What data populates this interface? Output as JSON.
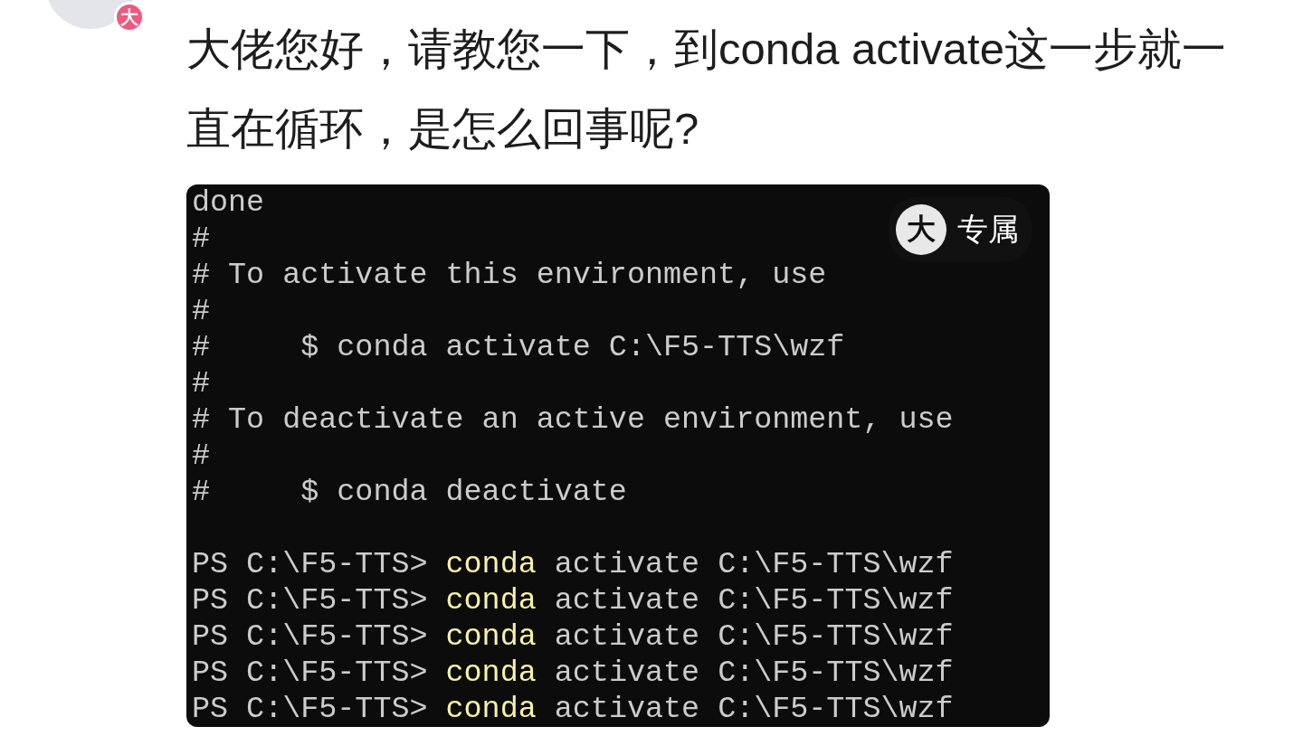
{
  "comment": {
    "avatar_badge": "大",
    "text": "大佬您好，请教您一下，到conda activate这一步就一直在循环，是怎么回事呢?"
  },
  "screenshot": {
    "badge": {
      "icon": "大",
      "label": "专属"
    },
    "lines": [
      {
        "kind": "plain",
        "text": "done"
      },
      {
        "kind": "plain",
        "text": "#"
      },
      {
        "kind": "plain",
        "text": "# To activate this environment, use"
      },
      {
        "kind": "plain",
        "text": "#"
      },
      {
        "kind": "plain",
        "text": "#     $ conda activate C:\\F5-TTS\\wzf"
      },
      {
        "kind": "plain",
        "text": "#"
      },
      {
        "kind": "plain",
        "text": "# To deactivate an active environment, use"
      },
      {
        "kind": "plain",
        "text": "#"
      },
      {
        "kind": "plain",
        "text": "#     $ conda deactivate"
      },
      {
        "kind": "blank"
      },
      {
        "kind": "prompt",
        "prompt": "PS C:\\F5-TTS>",
        "command": "conda",
        "args": "activate C:\\F5-TTS\\wzf"
      },
      {
        "kind": "prompt",
        "prompt": "PS C:\\F5-TTS>",
        "command": "conda",
        "args": "activate C:\\F5-TTS\\wzf"
      },
      {
        "kind": "prompt",
        "prompt": "PS C:\\F5-TTS>",
        "command": "conda",
        "args": "activate C:\\F5-TTS\\wzf"
      },
      {
        "kind": "prompt",
        "prompt": "PS C:\\F5-TTS>",
        "command": "conda",
        "args": "activate C:\\F5-TTS\\wzf"
      },
      {
        "kind": "prompt",
        "prompt": "PS C:\\F5-TTS>",
        "command": "conda",
        "args": "activate C:\\F5-TTS\\wzf"
      }
    ]
  }
}
